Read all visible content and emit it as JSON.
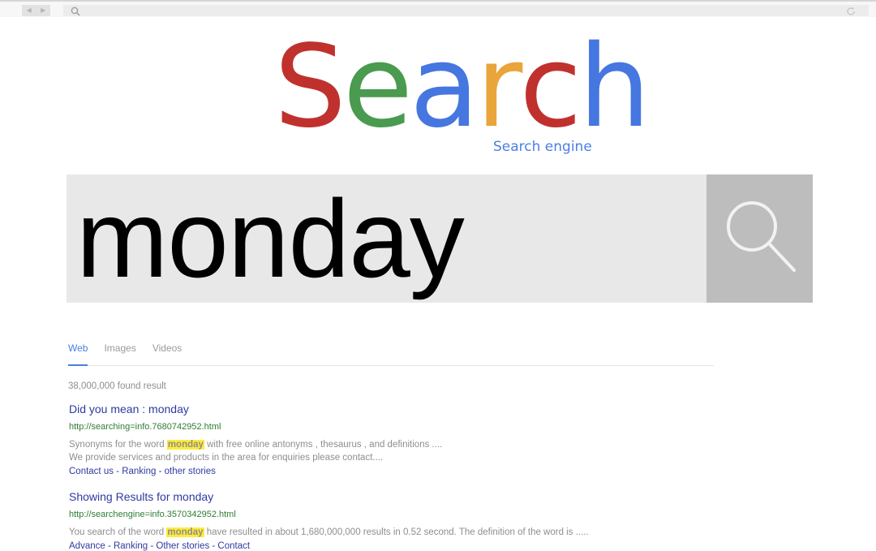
{
  "browser": {
    "back_icon": "triangle-left",
    "forward_icon": "triangle-right",
    "search_icon": "magnifier",
    "reload_icon": "reload"
  },
  "logo": {
    "letters": [
      {
        "char": "S",
        "color": "#c0312e"
      },
      {
        "char": "e",
        "color": "#4a9a4f"
      },
      {
        "char": "a",
        "color": "#4676e0"
      },
      {
        "char": "r",
        "color": "#e9a43a"
      },
      {
        "char": "c",
        "color": "#c0312e"
      },
      {
        "char": "h",
        "color": "#4676e0"
      }
    ],
    "subtitle": "Search engine"
  },
  "search": {
    "query": "monday",
    "button_icon": "magnifier"
  },
  "tabs": [
    {
      "label": "Web",
      "active": true
    },
    {
      "label": "Images",
      "active": false
    },
    {
      "label": "Videos",
      "active": false
    }
  ],
  "results_count": "38,000,000 found result",
  "results": [
    {
      "title": "Did you mean : monday",
      "url": "http://searching=info.7680742952.html",
      "desc_before": "Synonyms for the word ",
      "desc_highlight": "monday",
      "desc_after": " with free online antonyms , thesaurus , and definitions ....",
      "desc_line2": "We provide services and products in the area for enquiries please contact....",
      "links": "Contact us - Ranking - other stories"
    },
    {
      "title": "Showing Results for monday",
      "url": "http://searchengine=info.3570342952.html",
      "desc_before": "You search of the word ",
      "desc_highlight": "monday",
      "desc_after": " have resulted in about 1,680,000,000 results in 0.52 second. The definition of the word is .....",
      "links": "Advance - Ranking - Other stories - Contact"
    }
  ]
}
